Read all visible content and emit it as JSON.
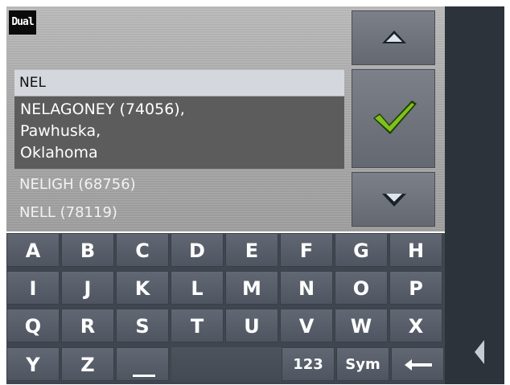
{
  "header": {
    "logo_text": "Dual"
  },
  "search": {
    "value": "NEL"
  },
  "results": {
    "selected": {
      "line1": "NELAGONEY (74056),",
      "line2": "Pawhuska,",
      "line3": "Oklahoma"
    },
    "items": [
      {
        "label": "NELIGH (68756)"
      },
      {
        "label": "NELL (78119)"
      }
    ]
  },
  "buttons": {
    "scroll_up_icon": "triangle-up-icon",
    "confirm_icon": "check-icon",
    "scroll_down_icon": "triangle-down-icon",
    "back_icon": "triangle-left-icon"
  },
  "keyboard": {
    "row1": [
      "A",
      "B",
      "C",
      "D",
      "E",
      "F",
      "G",
      "H"
    ],
    "row2": [
      "I",
      "J",
      "K",
      "L",
      "M",
      "N",
      "O",
      "P"
    ],
    "row3": [
      "Q",
      "R",
      "S",
      "T",
      "U",
      "V",
      "W",
      "X"
    ],
    "row4": {
      "y": "Y",
      "z": "Z",
      "numeric": "123",
      "symbols": "Sym"
    }
  },
  "colors": {
    "panel_dark": "#2d333b",
    "key_face": "#5a616b",
    "selection": "#5c5c5c",
    "check": "#7ec21b"
  }
}
